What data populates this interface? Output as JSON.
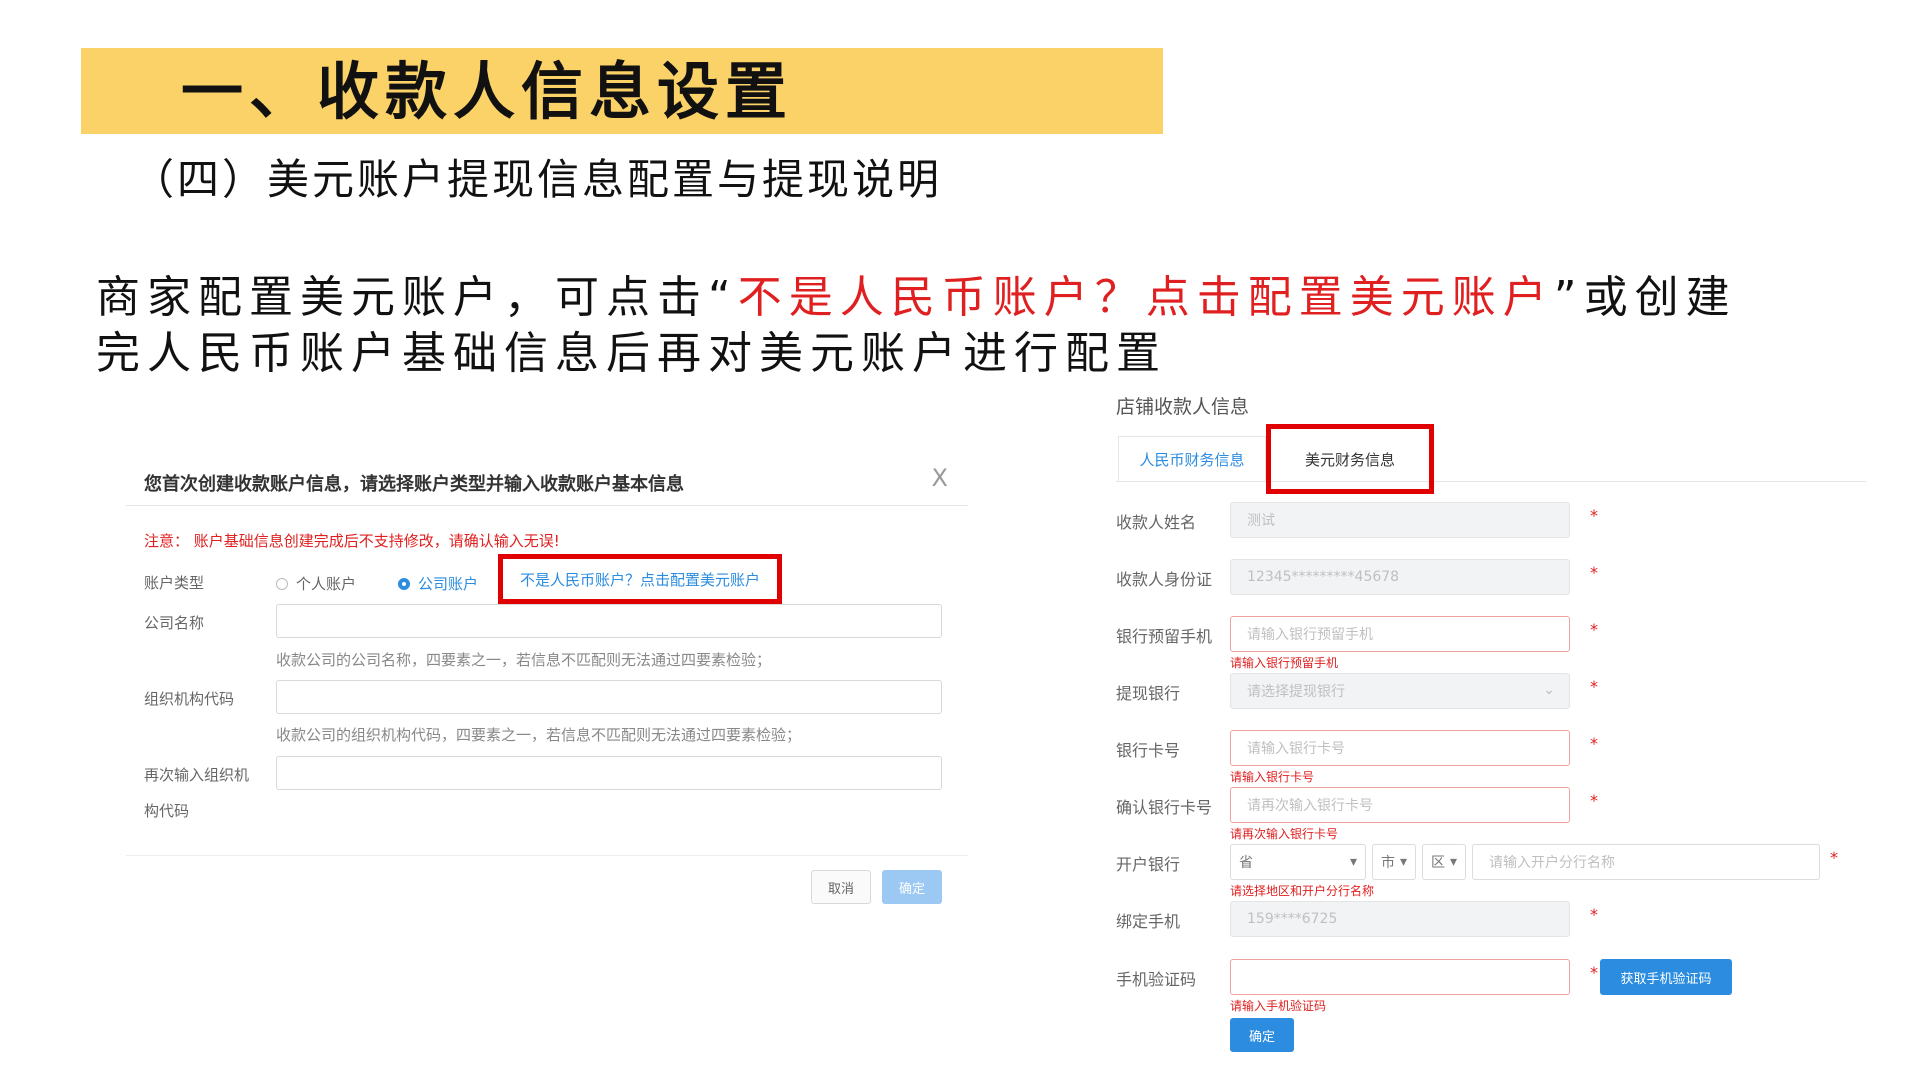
{
  "slide": {
    "title": "一、收款人信息设置",
    "subtitle": "（四）美元账户提现信息配置与提现说明",
    "desc_prefix": "商家配置美元账户，可点击“",
    "desc_highlight": "不是人民币账户？点击配置美元账户",
    "desc_suffix": "”或创建完人民币账户基础信息后再对美元账户进行配置"
  },
  "dialog": {
    "title": "您首次创建收款账户信息，请选择账户类型并输入收款账户基本信息",
    "close": "X",
    "warning": "注意：  账户基础信息创建完成后不支持修改，请确认输入无误!",
    "account_type_label": "账户类型",
    "radio_personal": "个人账户",
    "radio_company": "公司账户",
    "usd_link": "不是人民币账户？点击配置美元账户",
    "company_name_label": "公司名称",
    "company_name_hint": "收款公司的公司名称，四要素之一，若信息不匹配则无法通过四要素检验；",
    "org_code_label": "组织机构代码",
    "org_code_hint": "收款公司的组织机构代码，四要素之一，若信息不匹配则无法通过四要素检验；",
    "org_code_confirm_label_1": "再次输入组织机",
    "org_code_confirm_label_2": "构代码",
    "cancel": "取消",
    "ok": "确定"
  },
  "form": {
    "title": "店铺收款人信息",
    "tab_cny": "人民币财务信息",
    "tab_usd": "美元财务信息",
    "payee_name_label": "收款人姓名",
    "payee_name_value": "测试",
    "payee_id_label": "收款人身份证",
    "payee_id_value": "12345*********45678",
    "bank_phone_label": "银行预留手机",
    "bank_phone_placeholder": "请输入银行预留手机",
    "bank_phone_error": "请输入银行预留手机",
    "withdraw_bank_label": "提现银行",
    "withdraw_bank_placeholder": "请选择提现银行",
    "card_no_label": "银行卡号",
    "card_no_placeholder": "请输入银行卡号",
    "card_no_error": "请输入银行卡号",
    "card_confirm_label": "确认银行卡号",
    "card_confirm_placeholder": "请再次输入银行卡号",
    "card_confirm_error": "请再次输入银行卡号",
    "open_bank_label": "开户银行",
    "province": "省",
    "city": "市",
    "district": "区",
    "branch_placeholder": "请输入开户分行名称",
    "open_bank_error": "请选择地区和开户分行名称",
    "bind_phone_label": "绑定手机",
    "bind_phone_value": "159****6725",
    "sms_code_label": "手机验证码",
    "sms_code_error": "请输入手机验证码",
    "get_code_button": "获取手机验证码",
    "ok": "确定",
    "required": "*"
  }
}
